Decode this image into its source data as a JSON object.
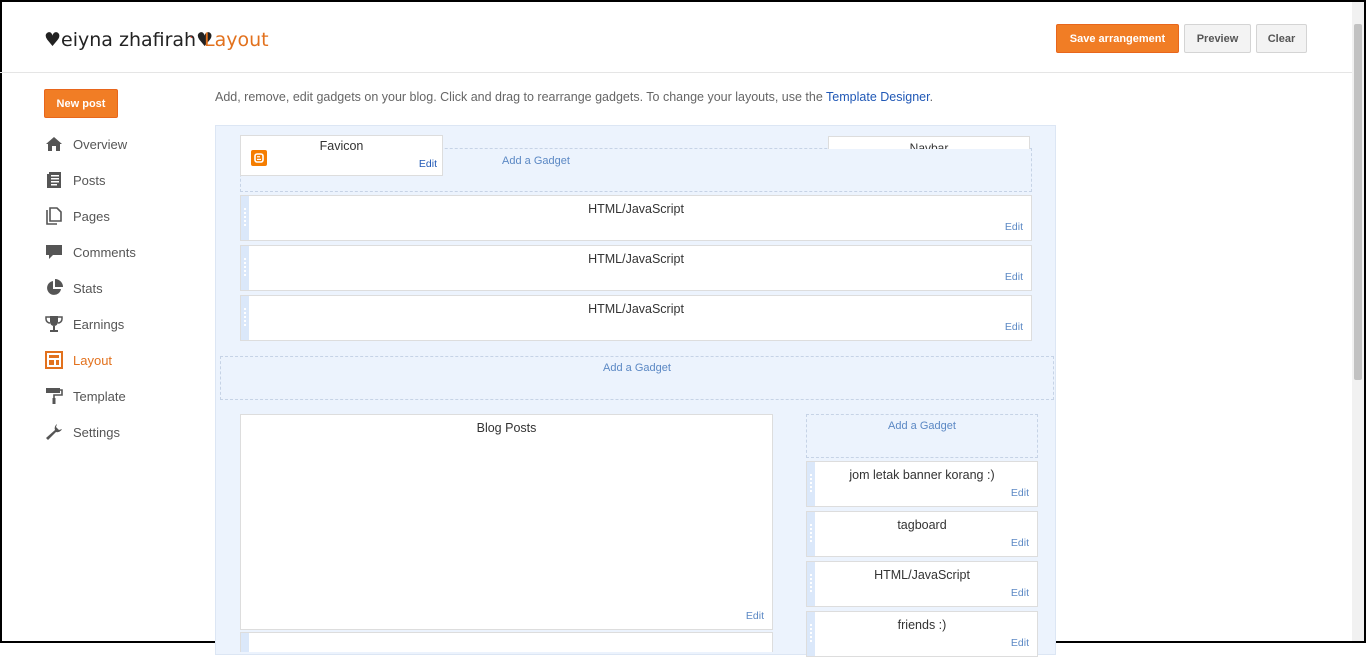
{
  "header": {
    "blog_title": "♥eiyna zhafirah♥",
    "separator": "·",
    "page_name": "Layout",
    "save_label": "Save arrangement",
    "preview_label": "Preview",
    "clear_label": "Clear"
  },
  "sidebar": {
    "new_post_label": "New post",
    "items": [
      {
        "label": "Overview",
        "icon": "home-icon"
      },
      {
        "label": "Posts",
        "icon": "posts-icon"
      },
      {
        "label": "Pages",
        "icon": "pages-icon"
      },
      {
        "label": "Comments",
        "icon": "comment-icon"
      },
      {
        "label": "Stats",
        "icon": "pie-chart-icon"
      },
      {
        "label": "Earnings",
        "icon": "trophy-icon"
      },
      {
        "label": "Layout",
        "icon": "layout-icon",
        "active": true
      },
      {
        "label": "Template",
        "icon": "paint-roller-icon"
      },
      {
        "label": "Settings",
        "icon": "wrench-icon"
      }
    ]
  },
  "intro": {
    "text": "Add, remove, edit gadgets on your blog. Click and drag to rearrange gadgets. To change your layouts, use the ",
    "link": "Template Designer",
    "end": "."
  },
  "layout": {
    "favicon": {
      "title": "Favicon",
      "edit": "Edit"
    },
    "navbar": {
      "title": "Navbar"
    },
    "add_gadget": "Add a Gadget",
    "header_gadgets": [
      {
        "title": "HTML/JavaScript",
        "edit": "Edit"
      },
      {
        "title": "HTML/JavaScript",
        "edit": "Edit"
      },
      {
        "title": "HTML/JavaScript",
        "edit": "Edit"
      }
    ],
    "blog_posts": {
      "title": "Blog Posts",
      "edit": "Edit"
    },
    "sidebar_gadgets": [
      {
        "title": "jom letak banner korang :)",
        "edit": "Edit"
      },
      {
        "title": "tagboard",
        "edit": "Edit"
      },
      {
        "title": "HTML/JavaScript",
        "edit": "Edit"
      },
      {
        "title": "friends :)",
        "edit": "Edit"
      }
    ]
  },
  "colors": {
    "accent": "#f17d25",
    "link": "#2058b6",
    "canvas": "#ecf3fd"
  }
}
